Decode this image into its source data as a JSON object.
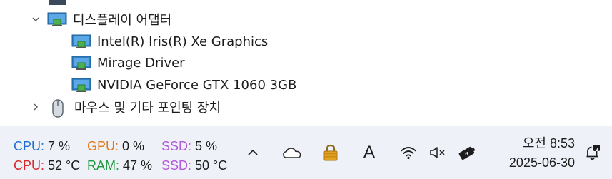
{
  "tree": {
    "top_partial_label": "",
    "display_adapters": {
      "label": "디스플레이 어댑터",
      "children": [
        "Intel(R) Iris(R) Xe Graphics",
        "Mirage Driver",
        "NVIDIA GeForce GTX 1060 3GB"
      ]
    },
    "mice": {
      "label": "마우스 및 기타 포인팅 장치"
    }
  },
  "stats": {
    "cpu_label": "CPU:",
    "cpu_usage": "7 %",
    "gpu_label": "GPU:",
    "gpu_usage": "0 %",
    "ssd_label": "SSD:",
    "ssd_usage": "5 %",
    "cpu_temp_label": "CPU:",
    "cpu_temp": "52 °C",
    "ram_label": "RAM:",
    "ram_usage": "47 %",
    "ssd_temp_label": "SSD:",
    "ssd_temp": "50 °C"
  },
  "colors": {
    "cpu": "#1f6fd1",
    "cpu_temp": "#d42a2a",
    "gpu": "#e07a1f",
    "ram": "#1e9a3e",
    "ssd": "#b25ad8",
    "taskbar": "#eef2f8"
  },
  "tray": {
    "icons": [
      "chevron-up-icon",
      "onedrive-cloud-icon",
      "lock-app-icon",
      "ime-icon",
      "wifi-icon",
      "volume-muted-icon",
      "battery-charging-icon",
      "notification-bell-icon"
    ],
    "ime_glyph": "A",
    "notification_badge": "z"
  },
  "clock": {
    "time": "오전 8:53",
    "date": "2025-06-30"
  }
}
